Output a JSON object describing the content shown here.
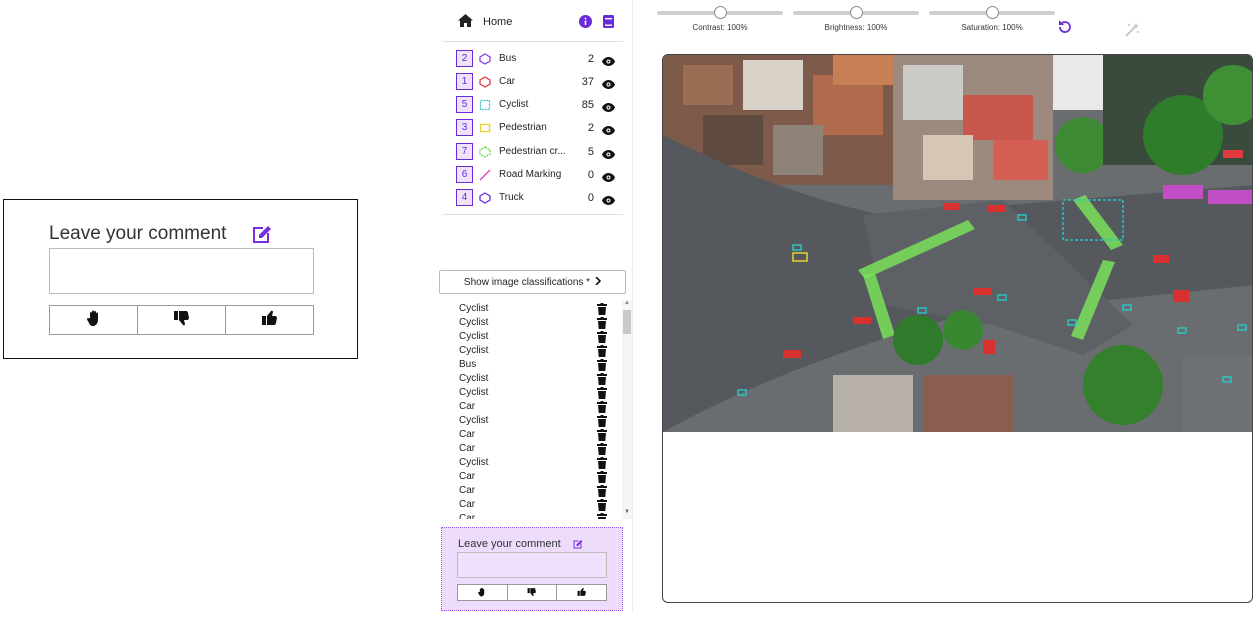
{
  "zoom": {
    "title": "Leave your comment",
    "buttons": [
      "hand-icon",
      "thumbs-down-icon",
      "thumbs-up-icon"
    ]
  },
  "nav": {
    "home_label": "Home",
    "icons": [
      "home-icon",
      "info-icon",
      "book-icon"
    ]
  },
  "classes": [
    {
      "key": "2",
      "name": "Bus",
      "count": "2",
      "color": "#8a3ce0",
      "shape": "polygon"
    },
    {
      "key": "1",
      "name": "Car",
      "count": "37",
      "color": "#e03a3a",
      "shape": "polygon"
    },
    {
      "key": "5",
      "name": "Cyclist",
      "count": "85",
      "color": "#2bc3c3",
      "shape": "bbox"
    },
    {
      "key": "3",
      "name": "Pedestrian",
      "count": "2",
      "color": "#e6d32a",
      "shape": "bbox"
    },
    {
      "key": "7",
      "name": "Pedestrian cr...",
      "count": "5",
      "color": "#5ed63a",
      "shape": "polygon"
    },
    {
      "key": "6",
      "name": "Road Marking",
      "count": "0",
      "color": "#e040c8",
      "shape": "line"
    },
    {
      "key": "4",
      "name": "Truck",
      "count": "0",
      "color": "#6a2bd9",
      "shape": "polygon"
    }
  ],
  "show_classifications_label": "Show image classifications *",
  "annotations": [
    "Cyclist",
    "Cyclist",
    "Cyclist",
    "Cyclist",
    "Bus",
    "Cyclist",
    "Cyclist",
    "Car",
    "Cyclist",
    "Car",
    "Car",
    "Cyclist",
    "Car",
    "Car",
    "Car",
    "Car"
  ],
  "comment": {
    "title": "Leave your comment",
    "placeholder": ""
  },
  "sliders": [
    {
      "label": "Contrast: 100%",
      "value_pct": 50
    },
    {
      "label": "Brightness: 100%",
      "value_pct": 50
    },
    {
      "label": "Saturation: 100%",
      "value_pct": 50
    }
  ],
  "colors": {
    "accent": "#6a2bd9",
    "comment_bg": "#eddcfb"
  }
}
